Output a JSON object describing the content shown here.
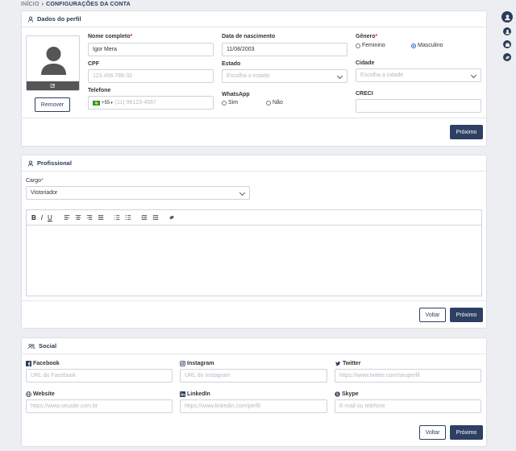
{
  "breadcrumb": {
    "home": "INÍCIO",
    "current": "CONFIGURAÇÕES DA CONTA"
  },
  "profile": {
    "title": "Dados do perfil",
    "remove_label": "Remover",
    "full_name": {
      "label": "Nome completo",
      "value": "Igor Mera"
    },
    "birth": {
      "label": "Data de nascimento",
      "value": "11/08/2003"
    },
    "gender": {
      "label": "Gênero",
      "options": [
        "Feminino",
        "Masculino"
      ],
      "selected": "Masculino"
    },
    "cpf": {
      "label": "CPF",
      "placeholder": "123.456.789-32"
    },
    "state": {
      "label": "Estado",
      "placeholder": "Escolha o estado"
    },
    "city": {
      "label": "Cidade",
      "placeholder": "Escolha a cidade"
    },
    "phone": {
      "label": "Telefone",
      "code": "+55",
      "placeholder": "(11) 96123-4567"
    },
    "whatsapp": {
      "label": "WhatsApp",
      "options": [
        "Sim",
        "Não"
      ]
    },
    "creci": {
      "label": "CRECI",
      "value": ""
    },
    "next_label": "Próximo"
  },
  "professional": {
    "title": "Profissional",
    "role": {
      "label": "Cargo",
      "value": "Vistoriador"
    },
    "toolbar": [
      "B",
      "I",
      "U"
    ],
    "back_label": "Voltar",
    "next_label": "Próximo"
  },
  "social": {
    "title": "Social",
    "facebook": {
      "label": "Facebook",
      "placeholder": "URL do Facebook"
    },
    "instagram": {
      "label": "Instagram",
      "placeholder": "URL do Instagram"
    },
    "twitter": {
      "label": "Twitter",
      "placeholder": "https://www.twitter.com/seuperfil"
    },
    "website": {
      "label": "Website",
      "placeholder": "https://www.seusite.com.br"
    },
    "linkedin": {
      "label": "LinkedIn",
      "placeholder": "https://www.linkedin.com/perfil"
    },
    "skype": {
      "label": "Skype",
      "placeholder": "E-mail ou telefone"
    },
    "back_label": "Voltar",
    "next_label": "Próximo"
  },
  "colors": {
    "primary": "#2d3f63",
    "accent": "#2463c9",
    "required": "#dd3333"
  },
  "icons": [
    "user-icon",
    "edit-icon",
    "briefcase-icon",
    "users-icon",
    "facebook-icon",
    "instagram-icon",
    "twitter-icon",
    "globe-icon",
    "linkedin-icon",
    "skype-icon",
    "link-icon"
  ]
}
